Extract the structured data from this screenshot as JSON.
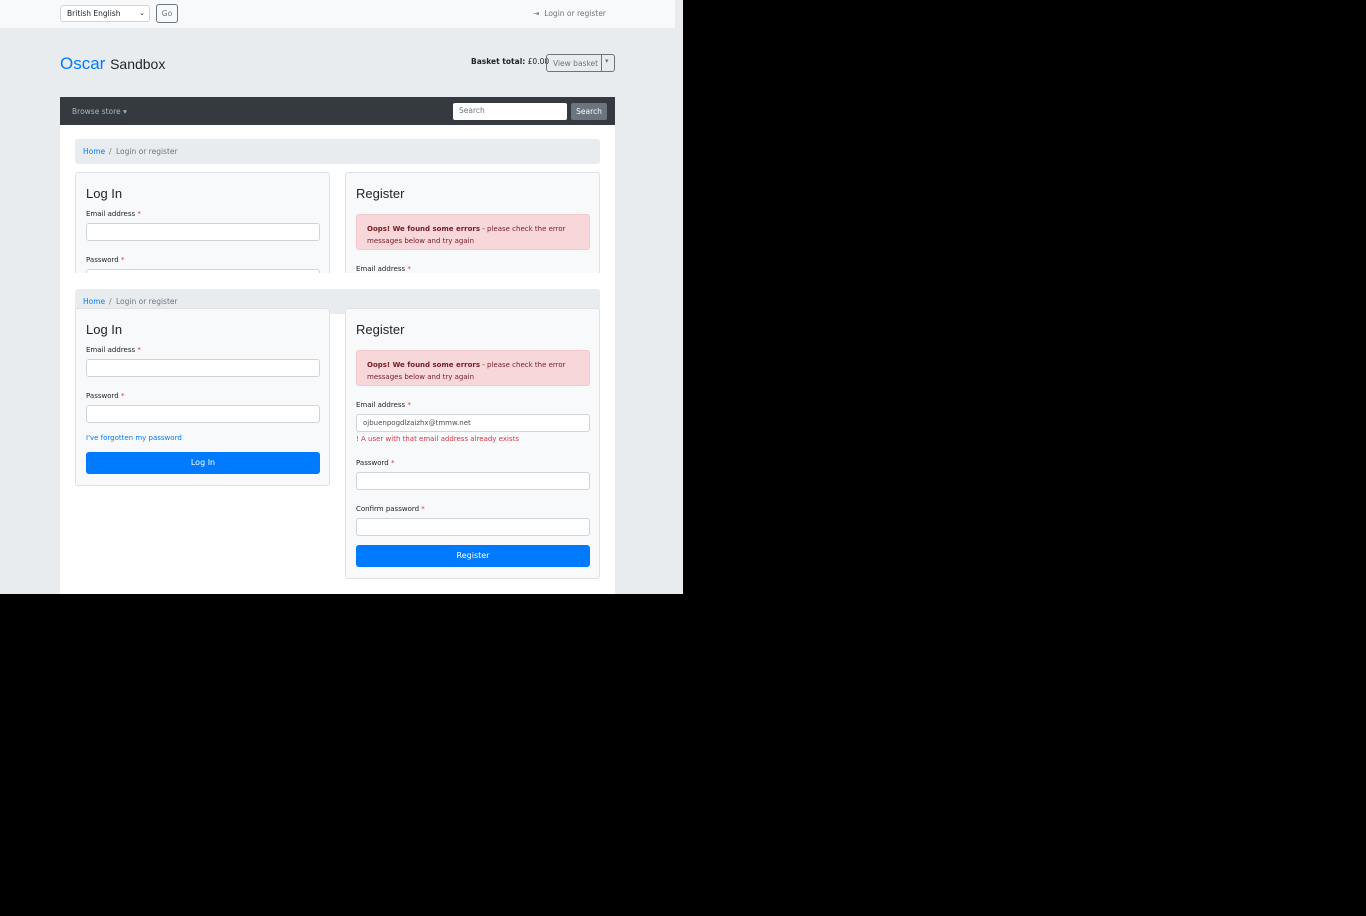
{
  "topbar": {
    "language": "British English",
    "go_label": "Go",
    "login_link": "Login or register"
  },
  "header": {
    "brand_main": "Oscar",
    "brand_sub": "Sandbox",
    "basket_total_label": "Basket total:",
    "basket_total_value": "£0.00",
    "view_basket_label": "View basket"
  },
  "navbar": {
    "browse_label": "Browse store",
    "search_placeholder": "Search",
    "search_button": "Search"
  },
  "breadcrumb": {
    "home": "Home",
    "separator": "/",
    "current": "Login or register"
  },
  "login": {
    "title": "Log In",
    "email_label": "Email address",
    "password_label": "Password",
    "required_marker": "*",
    "forgot_link": "I've forgotten my password",
    "submit_label": "Log In"
  },
  "register": {
    "title": "Register",
    "alert_strong": "Oops! We found some errors",
    "alert_dash": " - ",
    "alert_text": "please check the error messages below and try again",
    "email_label": "Email address",
    "email_value": "ojbuenpogdlzaizhx@tmmw.net",
    "email_error": "! A user with that email address already exists",
    "password_label": "Password",
    "confirm_label": "Confirm password",
    "submit_label": "Register"
  },
  "colors": {
    "primary": "#007bff",
    "navbar_bg": "#343a40",
    "alert_bg": "#f8d7da",
    "error_text": "#dc3545"
  }
}
